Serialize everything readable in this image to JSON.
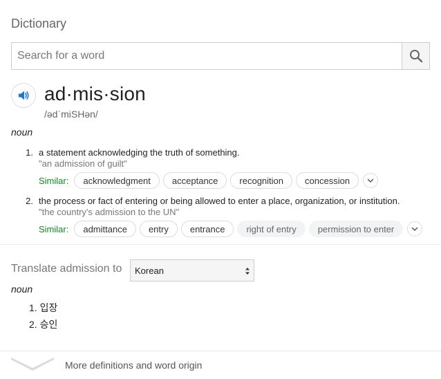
{
  "header": {
    "title": "Dictionary"
  },
  "search": {
    "placeholder": "Search for a word",
    "value": ""
  },
  "entry": {
    "headword": "ad·mis·sion",
    "phonetic": "/ədˈmiSHən/",
    "part_of_speech": "noun",
    "definitions": [
      {
        "number": "1.",
        "text": "a statement acknowledging the truth of something.",
        "example": "\"an admission of guilt\"",
        "similar_label": "Similar:",
        "similar": [
          "acknowledgment",
          "acceptance",
          "recognition",
          "concession"
        ]
      },
      {
        "number": "2.",
        "text": "the process or fact of entering or being allowed to enter a place, organization, or institution.",
        "example": "\"the country's admission to the UN\"",
        "similar_label": "Similar:",
        "similar": [
          "admittance",
          "entry",
          "entrance",
          "right of entry",
          "permission to enter"
        ]
      }
    ]
  },
  "translate": {
    "label": "Translate admission to",
    "selected_language": "Korean",
    "part_of_speech": "noun",
    "items": [
      "1. 입장",
      "2. 승인"
    ]
  },
  "footer": {
    "more_label": "More definitions and word origin"
  },
  "colors": {
    "similar_label": "#0d8d1f",
    "speaker_icon": "#1a73e8"
  },
  "icons": {
    "search": "search-icon",
    "speaker": "speaker-icon",
    "expand": "chevron-down-icon"
  }
}
